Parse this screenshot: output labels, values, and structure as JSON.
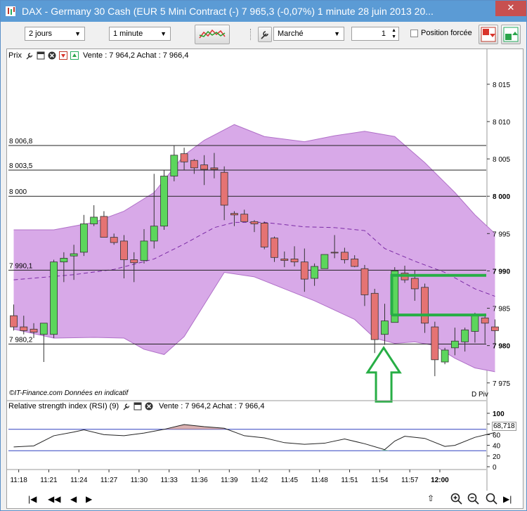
{
  "window": {
    "title": "DAX - Germany 30 Cash (EUR 5 Mini Contract (-)    7 965,3 (-0,07%)     1 minute   28 juin 2013 20..."
  },
  "toolbar": {
    "period_value": "2 jours",
    "interval_value": "1 minute",
    "order_type_value": "Marché",
    "quantity_value": "1",
    "forced_position_label": "Position forcée"
  },
  "price_panel": {
    "title": "Prix",
    "quote_text": "Vente : 7 964,2  Achat : 7 966,4",
    "level_labels": [
      "8 006,8",
      "8 003,5",
      "8 000",
      "7 990,1",
      "7 980,2"
    ],
    "credit": "©IT-Finance.com  Données en indicatif",
    "pivot_label": "D Piv"
  },
  "rsi_panel": {
    "title": "Relative strength index (RSI) (9)",
    "quote_text": "Vente : 7 964,2  Achat : 7 966,4",
    "current_value": "68,718",
    "axis_ticks": [
      "100",
      "80",
      "60",
      "40",
      "20",
      "0"
    ]
  },
  "chart_data": {
    "type": "candlestick",
    "price_axis_ticks": [
      "8 015",
      "8 010",
      "8 005",
      "8 000",
      "7 995",
      "7 990",
      "7 985",
      "7 980",
      "7 975"
    ],
    "ylim": [
      7973,
      8018
    ],
    "time_ticks": [
      "11:18",
      "11:21",
      "11:24",
      "11:27",
      "11:30",
      "11:33",
      "11:36",
      "11:39",
      "11:42",
      "11:45",
      "11:48",
      "11:51",
      "11:54",
      "11:57",
      "12:00"
    ],
    "horizontal_levels": [
      8006.8,
      8003.5,
      8000,
      7990.1,
      7980.2
    ],
    "candles": [
      {
        "o": 7984,
        "h": 7985.5,
        "l": 7982,
        "c": 7982.5
      },
      {
        "o": 7982.5,
        "h": 7984,
        "l": 7981.5,
        "c": 7982
      },
      {
        "o": 7982.2,
        "h": 7983,
        "l": 7981,
        "c": 7981.8
      },
      {
        "o": 7981.5,
        "h": 7983,
        "l": 7977.8,
        "c": 7983
      },
      {
        "o": 7981.5,
        "h": 7991.5,
        "l": 7981,
        "c": 7991.2
      },
      {
        "o": 7991.2,
        "h": 7992.5,
        "l": 7988.5,
        "c": 7991.7
      },
      {
        "o": 7992,
        "h": 7993.5,
        "l": 7988.8,
        "c": 7992.3
      },
      {
        "o": 7992.5,
        "h": 7997.5,
        "l": 7992,
        "c": 7996.3
      },
      {
        "o": 7996.3,
        "h": 7998.8,
        "l": 7996,
        "c": 7997.2
      },
      {
        "o": 7997.3,
        "h": 7998,
        "l": 7994.5,
        "c": 7994.5
      },
      {
        "o": 7994.5,
        "h": 7995,
        "l": 7993.5,
        "c": 7993.8
      },
      {
        "o": 7994,
        "h": 7994.8,
        "l": 7989,
        "c": 7991.5
      },
      {
        "o": 7991.5,
        "h": 7992.5,
        "l": 7988.5,
        "c": 7991.1
      },
      {
        "o": 7991.4,
        "h": 7995.6,
        "l": 7991,
        "c": 7994
      },
      {
        "o": 7994,
        "h": 8003,
        "l": 7993,
        "c": 7996
      },
      {
        "o": 7996,
        "h": 8003.5,
        "l": 7995.5,
        "c": 8002.7
      },
      {
        "o": 8002.7,
        "h": 8006.8,
        "l": 8002,
        "c": 8005.5
      },
      {
        "o": 8005.7,
        "h": 8006.5,
        "l": 8003.5,
        "c": 8004.6
      },
      {
        "o": 8004.8,
        "h": 8005,
        "l": 8003,
        "c": 8003.8
      },
      {
        "o": 8004.2,
        "h": 8005.5,
        "l": 8001.5,
        "c": 8003.6
      },
      {
        "o": 8003.8,
        "h": 8005.8,
        "l": 8002.4,
        "c": 8003.6
      },
      {
        "o": 8003.2,
        "h": 8004,
        "l": 7996.8,
        "c": 7998.8
      },
      {
        "o": 7997.7,
        "h": 7998,
        "l": 7996,
        "c": 7997.5
      },
      {
        "o": 7997.6,
        "h": 7998.2,
        "l": 7996.6,
        "c": 7996.6
      },
      {
        "o": 7996.6,
        "h": 7996.8,
        "l": 7995.2,
        "c": 7996.3
      },
      {
        "o": 7996.4,
        "h": 7996.6,
        "l": 7992.9,
        "c": 7993.2
      },
      {
        "o": 7994.4,
        "h": 7994.6,
        "l": 7991.2,
        "c": 7991.8
      },
      {
        "o": 7991.6,
        "h": 7992.6,
        "l": 7990.5,
        "c": 7991.4
      },
      {
        "o": 7991.6,
        "h": 7993.3,
        "l": 7990.6,
        "c": 7991.2
      },
      {
        "o": 7991.2,
        "h": 7993,
        "l": 7987.2,
        "c": 7988.9
      },
      {
        "o": 7989,
        "h": 7991,
        "l": 7988,
        "c": 7990.6
      },
      {
        "o": 7990.3,
        "h": 7992,
        "l": 7990.5,
        "c": 7992.2
      },
      {
        "o": 7992.5,
        "h": 7994.8,
        "l": 7991.7,
        "c": 7992.4
      },
      {
        "o": 7992.5,
        "h": 7993.1,
        "l": 7991,
        "c": 7991.5
      },
      {
        "o": 7991.6,
        "h": 7992.1,
        "l": 7990.5,
        "c": 7990.6
      },
      {
        "o": 7990.3,
        "h": 7990.8,
        "l": 7985.3,
        "c": 7986.8
      },
      {
        "o": 7987,
        "h": 7987.6,
        "l": 7979,
        "c": 7980.8
      },
      {
        "o": 7981.5,
        "h": 7985.6,
        "l": 7980.1,
        "c": 7983.3
      },
      {
        "o": 7983.1,
        "h": 7990.5,
        "l": 7983.2,
        "c": 7990
      },
      {
        "o": 7989.7,
        "h": 7990.7,
        "l": 7988.4,
        "c": 7988.8
      },
      {
        "o": 7989,
        "h": 7990.1,
        "l": 7986,
        "c": 7987.6
      },
      {
        "o": 7987.8,
        "h": 7988.3,
        "l": 7981.7,
        "c": 7983
      },
      {
        "o": 7982.5,
        "h": 7983.2,
        "l": 7975.9,
        "c": 7978.1
      },
      {
        "o": 7977.8,
        "h": 7979.7,
        "l": 7977.5,
        "c": 7979.4
      },
      {
        "o": 7979.7,
        "h": 7982.4,
        "l": 7978.7,
        "c": 7980.6
      },
      {
        "o": 7980.5,
        "h": 7982.4,
        "l": 7979.2,
        "c": 7982.1
      },
      {
        "o": 7981.9,
        "h": 7984.4,
        "l": 7980.4,
        "c": 7984
      },
      {
        "o": 7983.7,
        "h": 7984.3,
        "l": 7980.3,
        "c": 7983
      },
      {
        "o": 7982.5,
        "h": 7983.5,
        "l": 7980.2,
        "c": 7982
      }
    ],
    "bollinger_upper": [
      [
        0,
        7995.5
      ],
      [
        4,
        7995.5
      ],
      [
        8,
        7996.5
      ],
      [
        11,
        7998
      ],
      [
        14,
        8000.5
      ],
      [
        17,
        8005.5
      ],
      [
        19,
        8007.5
      ],
      [
        22,
        8009.6
      ],
      [
        25,
        8008
      ],
      [
        29,
        8007.3
      ],
      [
        32,
        8008.1
      ],
      [
        35,
        8008.7
      ],
      [
        38,
        8008
      ],
      [
        41,
        8004.5
      ],
      [
        44,
        8000.5
      ],
      [
        46,
        7997.5
      ],
      [
        48,
        7995
      ]
    ],
    "bollinger_middle": [
      [
        0,
        7988.8
      ],
      [
        6,
        7989.5
      ],
      [
        10,
        7990.2
      ],
      [
        14,
        7991.6
      ],
      [
        17,
        7993.6
      ],
      [
        20,
        7995.8
      ],
      [
        22,
        7996.5
      ],
      [
        25,
        7996.5
      ],
      [
        29,
        7995.9
      ],
      [
        32,
        7995.8
      ],
      [
        35,
        7995.4
      ],
      [
        37,
        7993
      ],
      [
        40,
        7991.3
      ],
      [
        43,
        7989.8
      ],
      [
        46,
        7987.6
      ],
      [
        48,
        7986.6
      ]
    ],
    "bollinger_lower": [
      [
        0,
        7982.2
      ],
      [
        4,
        7981
      ],
      [
        8,
        7981.1
      ],
      [
        11,
        7981
      ],
      [
        13,
        7979.5
      ],
      [
        15,
        7978.8
      ],
      [
        17,
        7981.2
      ],
      [
        19,
        7985.5
      ],
      [
        21,
        7989.8
      ],
      [
        24,
        7989.2
      ],
      [
        27,
        7987.6
      ],
      [
        30,
        7986
      ],
      [
        34,
        7983.5
      ],
      [
        36,
        7981
      ],
      [
        38,
        7980.3
      ],
      [
        40,
        7980.5
      ],
      [
        42,
        7980
      ],
      [
        44,
        7978.3
      ],
      [
        46,
        7977
      ],
      [
        48,
        7976.5
      ]
    ],
    "rsi": [
      [
        0,
        37
      ],
      [
        2,
        39
      ],
      [
        4,
        58
      ],
      [
        6,
        65
      ],
      [
        7,
        69
      ],
      [
        9,
        60
      ],
      [
        11,
        58
      ],
      [
        13,
        63
      ],
      [
        15,
        70
      ],
      [
        17,
        79
      ],
      [
        19,
        75
      ],
      [
        21,
        72
      ],
      [
        23,
        58
      ],
      [
        25,
        54
      ],
      [
        27,
        45
      ],
      [
        29,
        42
      ],
      [
        31,
        44
      ],
      [
        33,
        52
      ],
      [
        35,
        43
      ],
      [
        37,
        32
      ],
      [
        38,
        48
      ],
      [
        39,
        57
      ],
      [
        41,
        53
      ],
      [
        43,
        38
      ],
      [
        44,
        40
      ],
      [
        46,
        55
      ],
      [
        48,
        64
      ]
    ],
    "rsi_levels": [
      70,
      30
    ]
  },
  "colors": {
    "bullish": "#5cd65c",
    "bearish": "#e57373",
    "band_fill": "#d8a9e8",
    "annotation": "#27ae45"
  }
}
